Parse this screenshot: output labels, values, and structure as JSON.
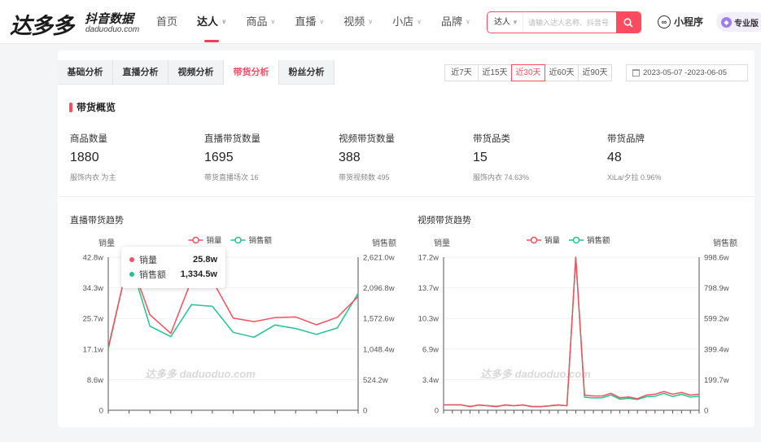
{
  "logo": {
    "main": "达多多",
    "cn": "抖音数据",
    "en": "daduoduo.com"
  },
  "nav": [
    {
      "label": "首页",
      "active": false,
      "caret": false
    },
    {
      "label": "达人",
      "active": true,
      "caret": true
    },
    {
      "label": "商品",
      "active": false,
      "caret": true
    },
    {
      "label": "直播",
      "active": false,
      "caret": true
    },
    {
      "label": "视频",
      "active": false,
      "caret": true
    },
    {
      "label": "小店",
      "active": false,
      "caret": true
    },
    {
      "label": "品牌",
      "active": false,
      "caret": true
    }
  ],
  "search": {
    "type": "达人",
    "placeholder": "请输入达人名称、抖音号"
  },
  "mini_program": "小程序",
  "pro": "专业版",
  "tabs": [
    {
      "label": "基础分析",
      "active": false
    },
    {
      "label": "直播分析",
      "active": false
    },
    {
      "label": "视频分析",
      "active": false
    },
    {
      "label": "带货分析",
      "active": true
    },
    {
      "label": "粉丝分析",
      "active": false
    }
  ],
  "ranges": [
    {
      "label": "近7天",
      "active": false
    },
    {
      "label": "近15天",
      "active": false
    },
    {
      "label": "近30天",
      "active": true
    },
    {
      "label": "近60天",
      "active": false
    },
    {
      "label": "近90天",
      "active": false
    }
  ],
  "date_range": "2023-05-07  -2023-06-05",
  "overview": {
    "title": "带货概览",
    "stats": [
      {
        "label": "商品数量",
        "value": "1880",
        "sub": "服饰内衣 为主"
      },
      {
        "label": "直播带货数量",
        "value": "1695",
        "sub": "带货直播场次 16"
      },
      {
        "label": "视频带货数量",
        "value": "388",
        "sub": "带货视频数 495"
      },
      {
        "label": "带货品类",
        "value": "15",
        "sub": "服饰内衣 74.63%"
      },
      {
        "label": "带货品牌",
        "value": "48",
        "sub": "XiLa/夕拉 0.96%"
      }
    ]
  },
  "colors": {
    "accent": "#ff4b5f",
    "sales": "#f2515f",
    "revenue": "#21c48a"
  },
  "chart_data": [
    {
      "type": "line",
      "title": "直播带货趋势",
      "ylabel_left": "销量",
      "ylabel_right": "销售额",
      "legend_placement": "top-center",
      "yticks_left": [
        "0",
        "8.6w",
        "17.1w",
        "25.7w",
        "34.3w",
        "42.8w"
      ],
      "yticks_right": [
        "0",
        "524.2w",
        "1,048.4w",
        "1,572.6w",
        "2,096.8w",
        "2,621.0w"
      ],
      "ylim_left": [
        0,
        42.8
      ],
      "ylim_right": [
        0,
        2621.0
      ],
      "series": [
        {
          "name": "销量",
          "axis": "left",
          "values": [
            17.5,
            42.8,
            26.7,
            21.5,
            36.4,
            36.3,
            25.8,
            24.8,
            25.9,
            26.1,
            23.9,
            26.0,
            31.8
          ]
        },
        {
          "name": "销售额",
          "axis": "right",
          "values": [
            1048.4,
            2621.0,
            1440.0,
            1260.0,
            1810.0,
            1780.0,
            1334.5,
            1250.0,
            1460.0,
            1400.0,
            1300.0,
            1410.0,
            2000.0
          ]
        }
      ],
      "tooltip": {
        "series": [
          {
            "name": "销量",
            "value": "25.8w"
          },
          {
            "name": "销售额",
            "value": "1,334.5w"
          }
        ]
      },
      "watermark": "达多多 daduoduo.com"
    },
    {
      "type": "line",
      "title": "视频带货趋势",
      "ylabel_left": "销量",
      "ylabel_right": "销售额",
      "legend_placement": "top-center",
      "yticks_left": [
        "0",
        "3.4w",
        "6.9w",
        "10.3w",
        "13.7w",
        "17.2w"
      ],
      "yticks_right": [
        "0",
        "199.7w",
        "399.4w",
        "599.2w",
        "798.9w",
        "998.6w"
      ],
      "ylim_left": [
        0,
        17.2
      ],
      "ylim_right": [
        0,
        998.6
      ],
      "series": [
        {
          "name": "销量",
          "axis": "left",
          "values": [
            0.6,
            0.6,
            0.6,
            0.4,
            0.6,
            0.5,
            0.4,
            0.6,
            0.5,
            0.6,
            0.4,
            0.4,
            0.5,
            0.6,
            0.5,
            17.2,
            1.7,
            1.6,
            1.6,
            1.9,
            1.4,
            1.5,
            1.3,
            1.7,
            1.8,
            2.1,
            1.8,
            2.0,
            1.7,
            1.8
          ]
        },
        {
          "name": "销售额",
          "axis": "right",
          "values": [
            35,
            35,
            35,
            25,
            33,
            30,
            26,
            33,
            30,
            34,
            25,
            24,
            28,
            33,
            30,
            998.6,
            85,
            80,
            82,
            100,
            72,
            78,
            70,
            88,
            92,
            110,
            90,
            104,
            86,
            92
          ]
        }
      ],
      "watermark": "达多多 daduoduo.com"
    }
  ]
}
